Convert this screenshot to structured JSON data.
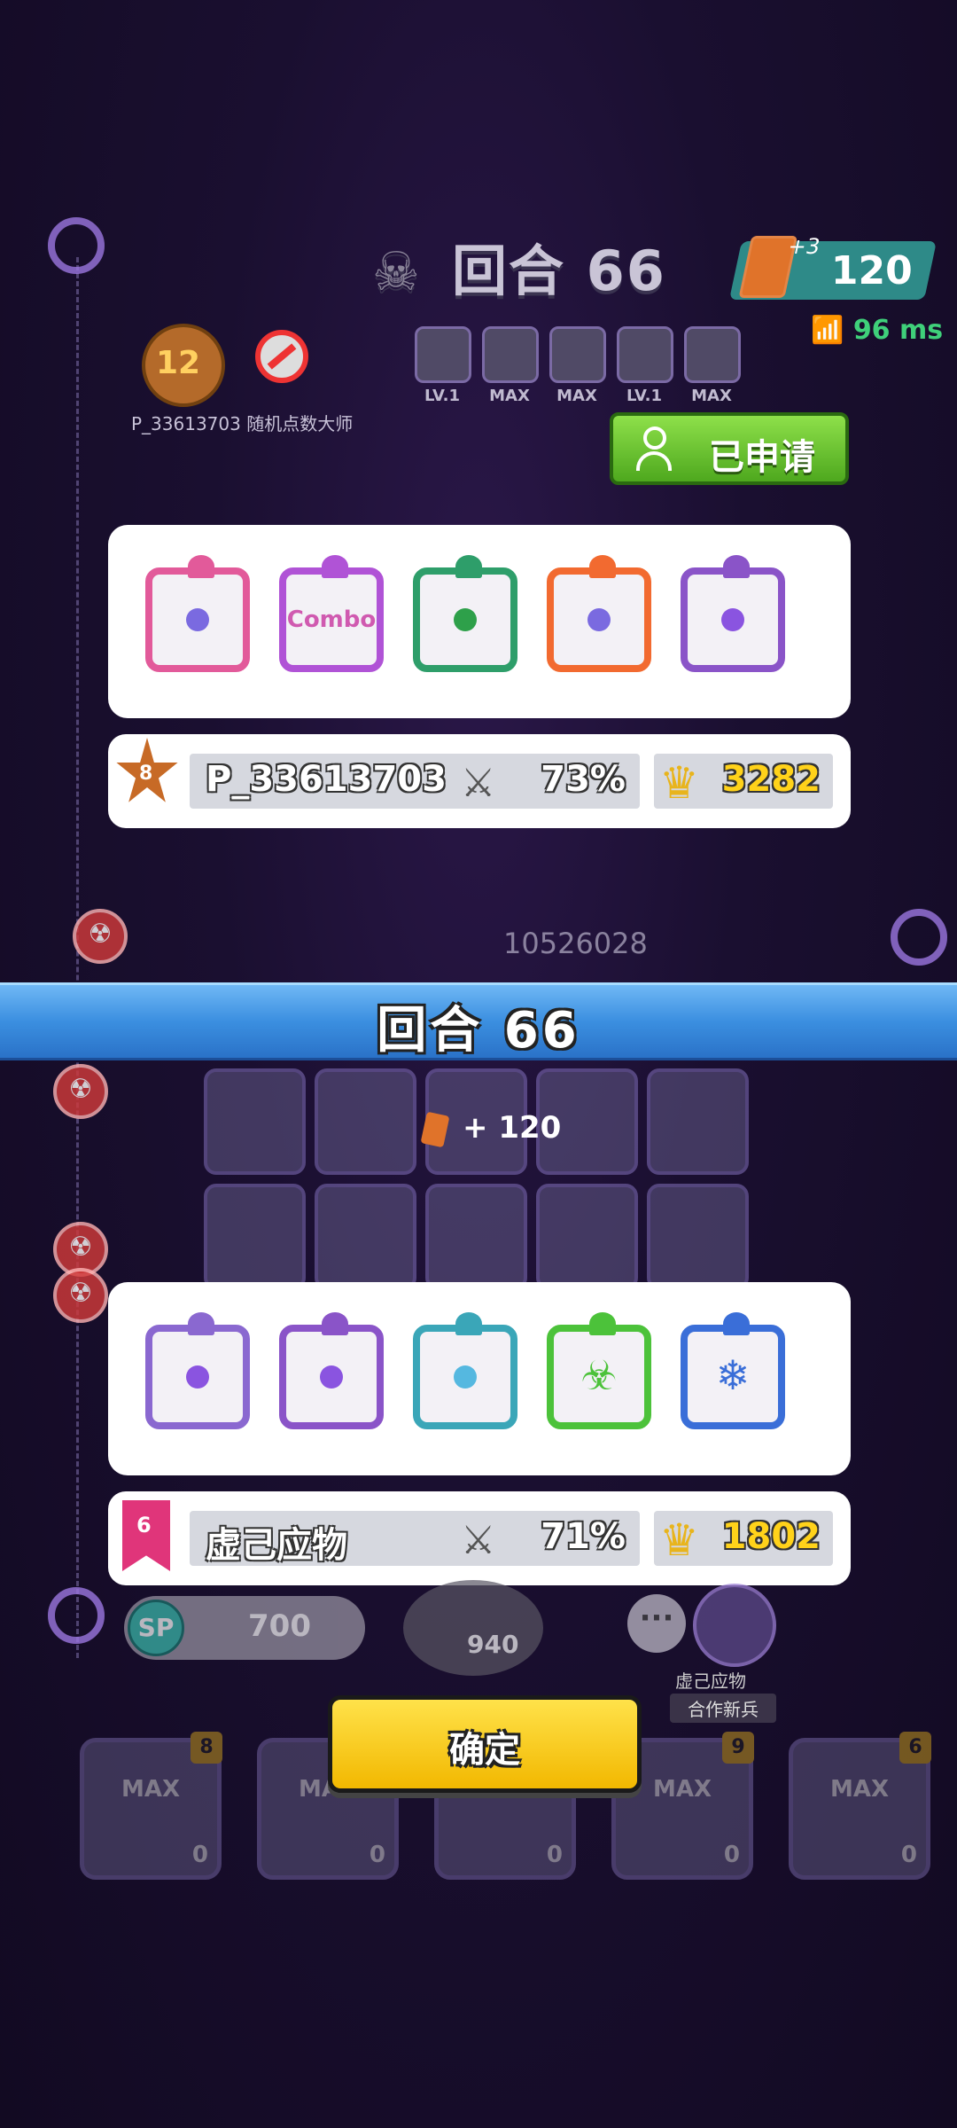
{
  "hud": {
    "round_label": "回合 66",
    "cards_bonus": "+3",
    "cards_value": "120",
    "ping": "96 ms"
  },
  "opponent_header": {
    "rank_level": "12",
    "name_line": "P_33613703  随机点数大师",
    "mini_deck_levels": [
      "LV.1",
      "MAX",
      "MAX",
      "LV.1",
      "MAX"
    ],
    "applied_button": "已申请"
  },
  "panel_top": {
    "dice": [
      {
        "name": "combo-rainbow-die",
        "border": "#e25a9a",
        "pip": "#7a6ae0",
        "label": ""
      },
      {
        "name": "combo-die",
        "border": "#b053d6",
        "pip": "#d05ab0",
        "label": "Combo"
      },
      {
        "name": "green-spiral-die",
        "border": "#2e9e6a",
        "pip": "#2ea04a",
        "label": ""
      },
      {
        "name": "rainbow-die",
        "border": "#f26a30",
        "pip": "#7a6ae0",
        "label": ""
      },
      {
        "name": "purple-triangle-die",
        "border": "#8a54c8",
        "pip": "#8a54e0",
        "label": ""
      }
    ],
    "rank": "8",
    "player_name": "P_33613703",
    "crit_pct": "73%",
    "gold": "3282"
  },
  "banner": {
    "text": "回合  66"
  },
  "board": {
    "gain": "+ 120",
    "boss_hp": "10526028"
  },
  "panel_bottom": {
    "dice": [
      {
        "name": "purple-wheel-die",
        "border": "#8a68d0",
        "pip": "#8a54e0",
        "sym": ""
      },
      {
        "name": "purple-triangle-die",
        "border": "#8a54c8",
        "pip": "#8a54e0",
        "sym": ""
      },
      {
        "name": "wind-swirl-die",
        "border": "#3aa6b8",
        "pip": "#55b8e0",
        "sym": ""
      },
      {
        "name": "biohazard-die",
        "border": "#4cc23a",
        "pip": "#3aa83a",
        "sym": "☣"
      },
      {
        "name": "snowflake-die",
        "border": "#3a6ed8",
        "pip": "",
        "sym": "❄"
      }
    ],
    "rank": "6",
    "player_name": "虚己应物",
    "crit_pct": "71%",
    "gold": "1802"
  },
  "bottom": {
    "sp_label": "SP",
    "sp_value": "700",
    "summon_cost": "940",
    "more": "···",
    "coop_name": "虚己应物",
    "coop_tag": "合作新兵",
    "confirm": "确定",
    "slots": [
      {
        "text": "MAX",
        "n": "0",
        "lvl": "8"
      },
      {
        "text": "MAX",
        "n": "0",
        "lvl": ""
      },
      {
        "text": "",
        "n": "0",
        "lvl": ""
      },
      {
        "text": "MAX",
        "n": "0",
        "lvl": "9"
      },
      {
        "text": "MAX",
        "n": "0",
        "lvl": "6"
      }
    ]
  },
  "colors": {
    "banner": "#3b8fe0",
    "confirm": "#ffd21a",
    "applied": "#6cc43a"
  }
}
